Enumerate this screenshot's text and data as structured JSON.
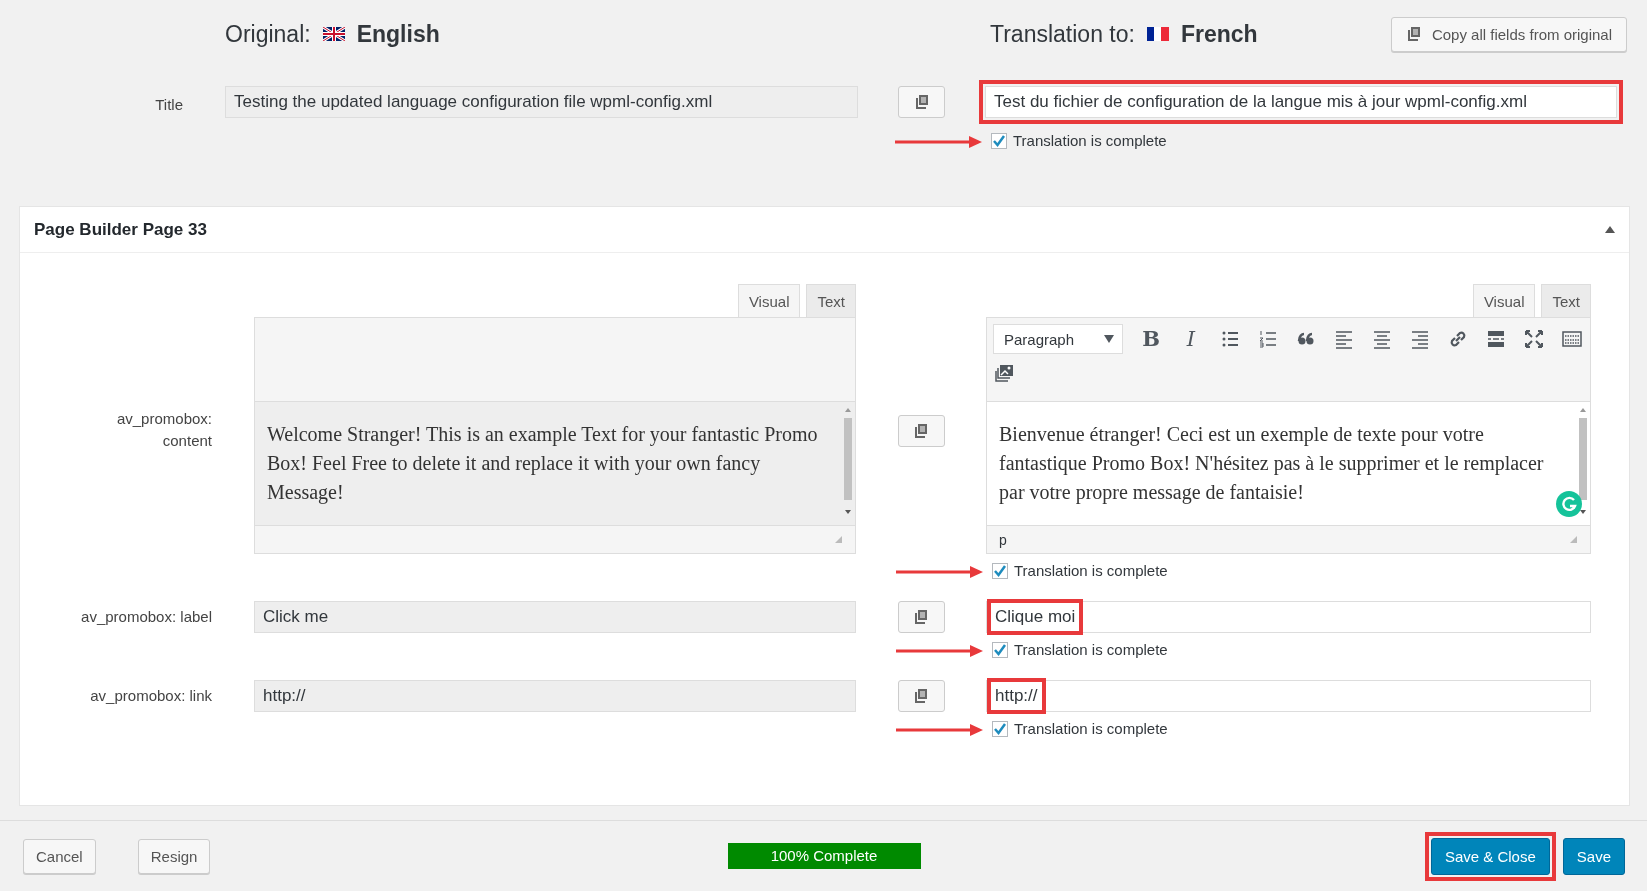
{
  "header": {
    "original_label": "Original:",
    "original_language": "English",
    "translation_label": "Translation to:",
    "translation_language": "French",
    "copy_all_button": "Copy all fields from original"
  },
  "title_field": {
    "label": "Title",
    "original": "Testing the updated language configuration file wpml-config.xml",
    "translation": "Test du fichier de configuration de la langue mis à jour wpml-config.xml",
    "highlighted": true,
    "complete": {
      "label": "Translation is complete",
      "checked": true,
      "arrow": true
    }
  },
  "panel": {
    "title": "Page Builder Page 33",
    "expanded": true,
    "fields": [
      {
        "kind": "editor",
        "label": "av_promobox: content",
        "original_tabs": [
          {
            "label": "Visual",
            "selected": true
          },
          {
            "label": "Text",
            "selected": false
          }
        ],
        "original": "Welcome Stranger! This is an example Text for your fantastic Promo Box! Feel Free to delete it and replace it with your own fancy Message!",
        "translation_tabs": [
          {
            "label": "Visual",
            "selected": true
          },
          {
            "label": "Text",
            "selected": false
          }
        ],
        "format": "Paragraph",
        "toolbar": [
          {
            "kind": "bold",
            "label": "B"
          },
          {
            "kind": "italic",
            "label": "I"
          },
          {
            "kind": "bullets"
          },
          {
            "kind": "numbers"
          },
          {
            "kind": "quote"
          },
          {
            "kind": "align-left"
          },
          {
            "kind": "align-center"
          },
          {
            "kind": "align-right"
          },
          {
            "kind": "link"
          },
          {
            "kind": "more"
          },
          {
            "kind": "fullscreen"
          },
          {
            "kind": "toolbar-toggle"
          },
          {
            "kind": "gallery"
          }
        ],
        "translation": "Bienvenue étranger! Ceci est un exemple de texte pour votre fantastique Promo Box! N'hésitez pas à le supprimer et le remplacer par votre propre message de fantaisie!",
        "status_path": "p",
        "complete": {
          "label": "Translation is complete",
          "checked": true,
          "arrow": true
        }
      },
      {
        "kind": "input",
        "label": "av_promobox: label",
        "original": "Click me",
        "translation": "Clique moi",
        "highlighted": true,
        "complete": {
          "label": "Translation is complete",
          "checked": true,
          "arrow": true
        }
      },
      {
        "kind": "input",
        "label": "av_promobox: link",
        "original": "http://",
        "translation": "http://",
        "highlighted": true,
        "complete": {
          "label": "Translation is complete",
          "checked": true,
          "arrow": true
        }
      }
    ]
  },
  "footer": {
    "left_buttons": [
      {
        "label": "Cancel"
      },
      {
        "label": "Resign"
      }
    ],
    "progress": {
      "label": "100% Complete",
      "level": 1
    },
    "right_buttons": [
      {
        "label": "Save & Close",
        "highlighted": true
      },
      {
        "label": "Save",
        "highlighted": false
      }
    ]
  }
}
